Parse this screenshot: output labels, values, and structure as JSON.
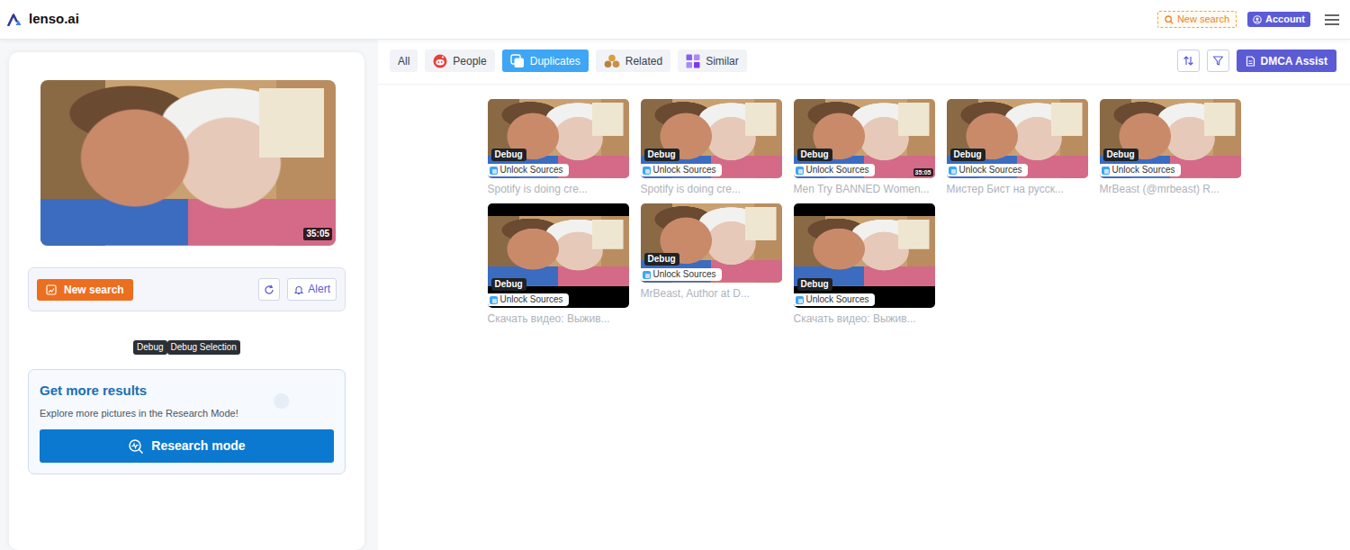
{
  "brand": {
    "name": "lenso.ai"
  },
  "header": {
    "new_search": "New search",
    "account": "Account"
  },
  "query": {
    "duration": "35:05"
  },
  "actions": {
    "new_search": "New search",
    "alert": "Alert"
  },
  "debug_tags": [
    "Debug",
    "Debug Selection"
  ],
  "promo": {
    "title": "Get more results",
    "text": "Explore more pictures in the Research Mode!",
    "button": "Research mode"
  },
  "tabs": [
    {
      "label": "All",
      "selected": false,
      "kind": "plain"
    },
    {
      "label": "People",
      "selected": false,
      "kind": "people"
    },
    {
      "label": "Duplicates",
      "selected": true,
      "kind": "duplicates"
    },
    {
      "label": "Related",
      "selected": false,
      "kind": "related"
    },
    {
      "label": "Similar",
      "selected": false,
      "kind": "similar"
    }
  ],
  "toolbar": {
    "dmca": "DMCA Assist"
  },
  "results": [
    {
      "badge": "Debug",
      "source": "Unlock Sources",
      "caption": "Spotify is doing cre...",
      "letterboxed": false
    },
    {
      "badge": "Debug",
      "source": "Unlock Sources",
      "caption": "Spotify is doing cre...",
      "letterboxed": false
    },
    {
      "badge": "Debug",
      "source": "Unlock Sources",
      "caption": "Men Try BANNED Women...",
      "letterboxed": false,
      "duration": "35:05"
    },
    {
      "badge": "Debug",
      "source": "Unlock Sources",
      "caption": "Мистер Бист на русск...",
      "letterboxed": false
    },
    {
      "badge": "Debug",
      "source": "Unlock Sources",
      "caption": "MrBeast (@mrbeast) R...",
      "letterboxed": false
    },
    {
      "badge": "Debug",
      "source": "Unlock Sources",
      "caption": "Скачать видео: Выжив...",
      "letterboxed": true
    },
    {
      "badge": "Debug",
      "source": "Unlock Sources",
      "caption": "MrBeast, Author at D...",
      "letterboxed": false
    },
    {
      "badge": "Debug",
      "source": "Unlock Sources",
      "caption": "Скачать видео: Выжив...",
      "letterboxed": true
    }
  ]
}
